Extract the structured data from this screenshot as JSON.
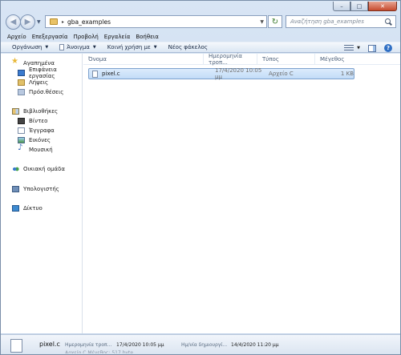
{
  "window": {
    "caption": {
      "minimize": "–",
      "maximize": "□",
      "close": "✕"
    }
  },
  "navigation": {
    "back_glyph": "◀",
    "forward_glyph": "▶",
    "history_glyph": "▼",
    "address": {
      "separator": "▸",
      "path": "gba_examples",
      "dropdown_glyph": "▼"
    },
    "refresh_glyph": "↻",
    "search": {
      "placeholder": "Αναζήτηση gba_examples"
    }
  },
  "menubar": [
    "Αρχείο",
    "Επεξεργασία",
    "Προβολή",
    "Εργαλεία",
    "Βοήθεια"
  ],
  "toolbar": {
    "organize": "Οργάνωση",
    "open": "Άνοιγμα",
    "share": "Κοινή χρήση με",
    "new_folder": "Νέος φάκελος",
    "caret": "▼",
    "help": "?"
  },
  "sidebar": {
    "favorites": {
      "header": "Αγαπημένα",
      "items": [
        "Επιφάνεια εργασίας",
        "Λήψεις",
        "Πρόσ.θέσεις"
      ]
    },
    "libraries": {
      "header": "Βιβλιοθήκες",
      "items": [
        "Βίντεο",
        "Έγγραφα",
        "Εικόνες",
        "Μουσική"
      ]
    },
    "homegroup": "Οικιακή ομάδα",
    "computer": "Υπολογιστής",
    "network": "Δίκτυο"
  },
  "file_list": {
    "columns": [
      "Όνομα",
      "Ημερομηνία τροπ...",
      "Τύπος",
      "Μέγεθος"
    ],
    "rows": [
      {
        "name": "pixel.c",
        "date": "17/4/2020 10:05 μμ",
        "type": "Αρχείο C",
        "size": "1 KB"
      }
    ]
  },
  "details": {
    "name": "pixel.c",
    "modified_label": "Ημερομηνία τροπ...",
    "modified_value": "17/4/2020 10:05 μμ",
    "created_label": "Ημ/νία δημιουργί...",
    "created_value": "14/4/2020 11:20 μμ",
    "size_line": "Αρχείο C   Μέγεθος: 517 byte"
  }
}
